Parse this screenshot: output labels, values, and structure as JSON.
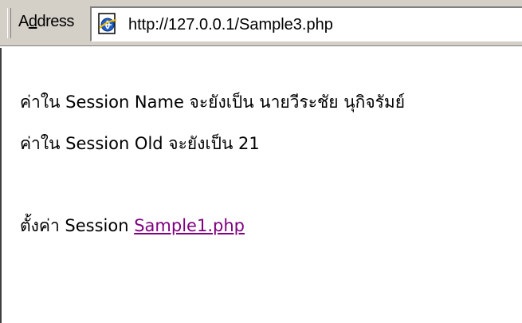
{
  "address_bar": {
    "label_prefix": "A",
    "label_underlined": "d",
    "label_suffix": "dress",
    "url": "http://127.0.0.1/Sample3.php",
    "icon": "ie-page-icon"
  },
  "content": {
    "line1": "ค่าใน Session Name จะยังเป็น นายวีระชัย นุกิจรัมย์",
    "line2": "ค่าใน Session Old จะยังเป็น 21",
    "line3_prefix": "ตั้งค่า Session ",
    "link_text": "Sample1.php"
  },
  "colors": {
    "chrome": "#d4d0c8",
    "visited_link": "#800080"
  }
}
